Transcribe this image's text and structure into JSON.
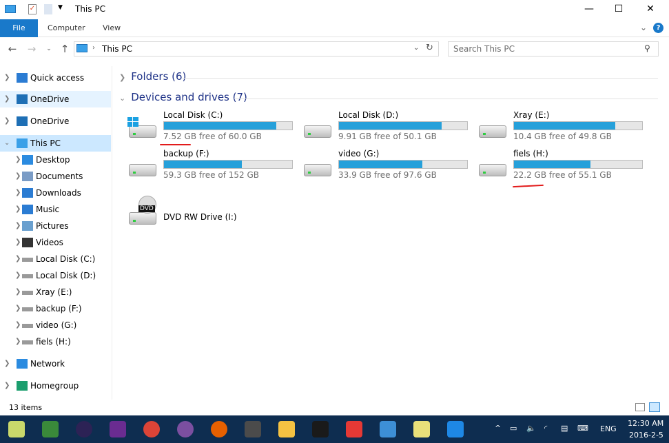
{
  "window": {
    "title": "This PC",
    "minimize": "—",
    "maximize": "☐",
    "close": "✕"
  },
  "ribbon": {
    "tabs": [
      "File",
      "Computer",
      "View"
    ],
    "help": "?",
    "expand": "⌄"
  },
  "nav": {
    "address": "This PC",
    "search_placeholder": "Search This PC"
  },
  "sidebar": {
    "items": [
      {
        "label": "Quick access",
        "icon": "star-icon"
      },
      {
        "label": "OneDrive",
        "icon": "cloud-icon"
      },
      {
        "label": "OneDrive",
        "icon": "cloud-icon"
      },
      {
        "label": "This PC",
        "icon": "computer-icon"
      },
      {
        "label": "Desktop",
        "icon": "desktop-icon"
      },
      {
        "label": "Documents",
        "icon": "documents-icon"
      },
      {
        "label": "Downloads",
        "icon": "download-icon"
      },
      {
        "label": "Music",
        "icon": "music-icon"
      },
      {
        "label": "Pictures",
        "icon": "pictures-icon"
      },
      {
        "label": "Videos",
        "icon": "videos-icon"
      },
      {
        "label": "Local Disk (C:)",
        "icon": "drive-icon"
      },
      {
        "label": "Local Disk (D:)",
        "icon": "drive-icon"
      },
      {
        "label": "Xray (E:)",
        "icon": "drive-icon"
      },
      {
        "label": "backup (F:)",
        "icon": "drive-icon"
      },
      {
        "label": "video (G:)",
        "icon": "drive-icon"
      },
      {
        "label": "fiels (H:)",
        "icon": "drive-icon"
      },
      {
        "label": "Network",
        "icon": "network-icon"
      },
      {
        "label": "Homegroup",
        "icon": "homegroup-icon"
      }
    ]
  },
  "main": {
    "folders_group": "Folders (6)",
    "devices_group": "Devices and drives (7)",
    "drives": [
      {
        "name": "Local Disk (C:)",
        "free": "7.52 GB free of 60.0 GB",
        "used_fraction": 0.875
      },
      {
        "name": "Local Disk (D:)",
        "free": "9.91 GB free of 50.1 GB",
        "used_fraction": 0.802
      },
      {
        "name": "Xray (E:)",
        "free": "10.4 GB free of 49.8 GB",
        "used_fraction": 0.791
      },
      {
        "name": "backup (F:)",
        "free": "59.3 GB free of 152 GB",
        "used_fraction": 0.61
      },
      {
        "name": "video (G:)",
        "free": "33.9 GB free of 97.6 GB",
        "used_fraction": 0.653
      },
      {
        "name": "fiels (H:)",
        "free": "22.2 GB free of 55.1 GB",
        "used_fraction": 0.597
      },
      {
        "name": "DVD RW Drive (I:)"
      }
    ],
    "dvd_label": "DVD"
  },
  "status": {
    "items": "13 items"
  },
  "taskbar": {
    "lang": "ENG",
    "time": "12:30 AM",
    "date": "2016-2-5"
  },
  "colors": {
    "accent": "#1979ca",
    "bar": "#26a0da",
    "taskbar": "#0e2d50",
    "annotation": "#e21b1b"
  }
}
